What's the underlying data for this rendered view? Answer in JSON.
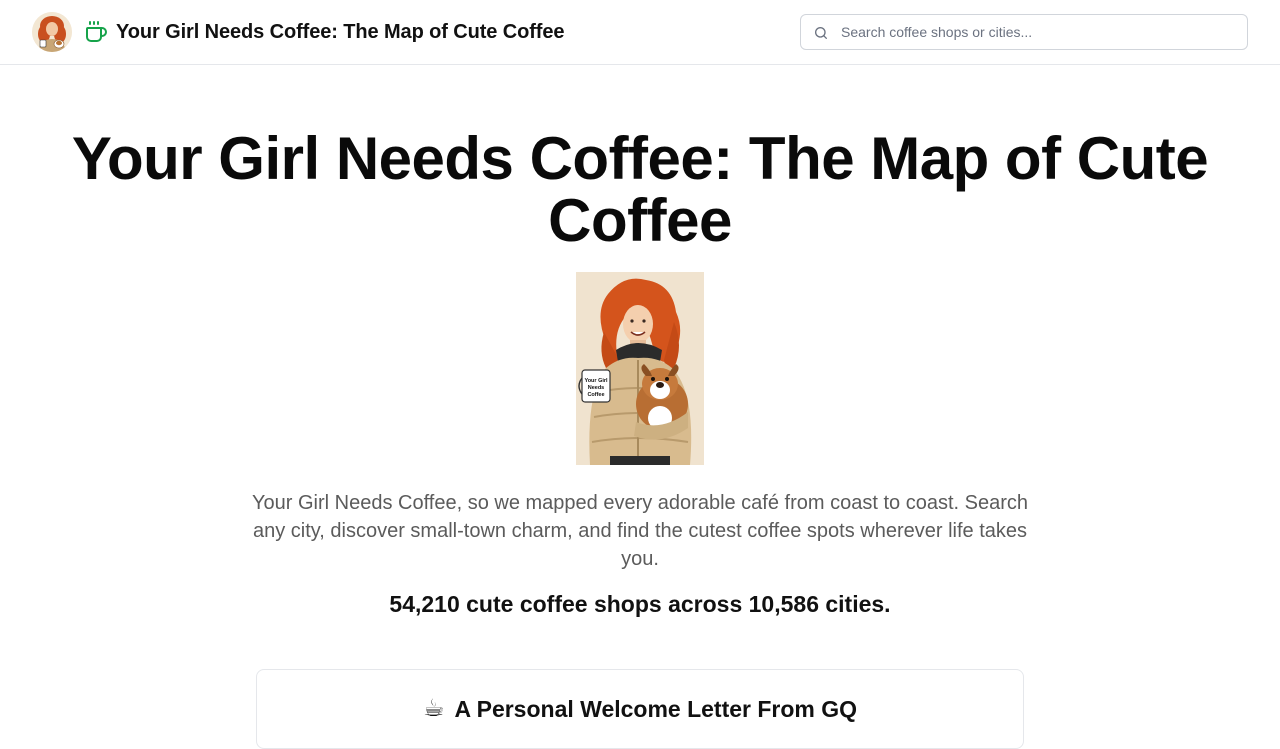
{
  "header": {
    "site_title": "Your Girl Needs Coffee: The Map of Cute Coffee",
    "search_placeholder": "Search coffee shops or cities..."
  },
  "hero": {
    "title": "Your Girl Needs Coffee: The Map of Cute Coffee",
    "intro": "Your Girl Needs Coffee, so we mapped every adorable café from coast to coast. Search any city, discover small-town charm, and find the cutest coffee spots wherever life takes you.",
    "stats": "54,210 cute coffee shops across 10,586 cities.",
    "mug_text": [
      "Your Girl",
      "Needs",
      "Coffee"
    ]
  },
  "welcome_card": {
    "emoji": "☕",
    "title": "A Personal Welcome Letter From GQ"
  },
  "colors": {
    "brand_green": "#16a34a",
    "hair": "#d4541c",
    "coat": "#d8bb8e",
    "background_portrait": "#f0e3cf"
  },
  "icons": {
    "cup": "coffee-cup-icon",
    "search": "search-icon"
  }
}
